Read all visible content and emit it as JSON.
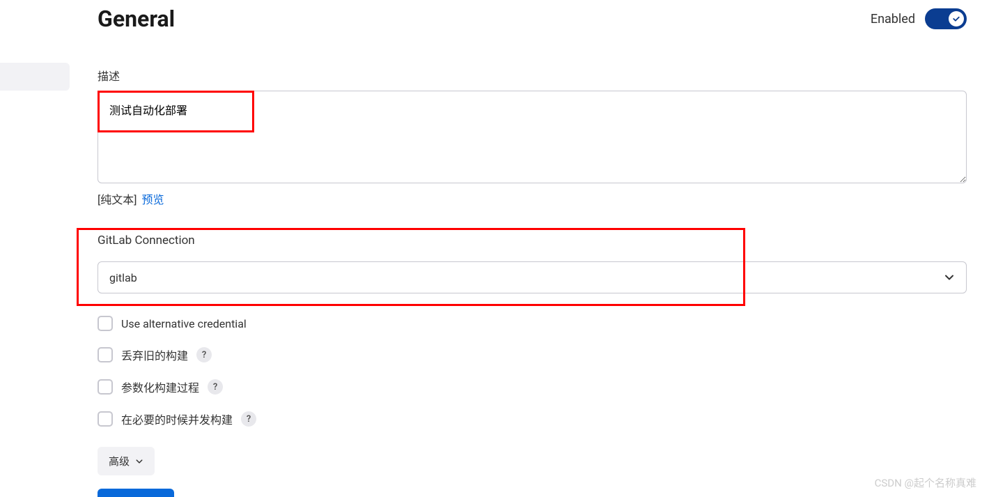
{
  "header": {
    "title": "General",
    "enabled_label": "Enabled",
    "enabled_state": true
  },
  "description": {
    "label": "描述",
    "value": "测试自动化部署",
    "plain_text_label": "[纯文本]",
    "preview_link": "预览"
  },
  "gitlab": {
    "label": "GitLab Connection",
    "value": "gitlab"
  },
  "checkboxes": [
    {
      "label": "Use alternative credential",
      "checked": false,
      "help": false
    },
    {
      "label": "丢弃旧的构建",
      "checked": false,
      "help": true
    },
    {
      "label": "参数化构建过程",
      "checked": false,
      "help": true
    },
    {
      "label": "在必要的时候并发构建",
      "checked": false,
      "help": true
    }
  ],
  "advanced_button": "高级",
  "watermark": "CSDN @起个名称真难",
  "colors": {
    "accent": "#0b3d91",
    "link": "#0969da",
    "highlight": "#ff0000"
  }
}
